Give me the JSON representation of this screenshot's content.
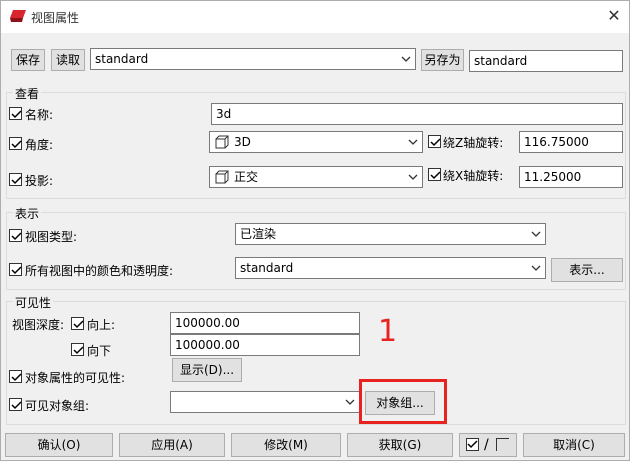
{
  "window": {
    "title": "视图属性",
    "close_glyph": "✕"
  },
  "toolbar": {
    "save": "保存",
    "read": "读取",
    "preset": "standard",
    "save_as": "另存为",
    "save_as_name": "standard"
  },
  "view": {
    "section_title": "查看",
    "name_label": "名称:",
    "name_value": "3d",
    "angle_label": "角度:",
    "angle_value": "3D",
    "rot_z_label": "绕Z轴旋转:",
    "rot_z_value": "116.75000",
    "projection_label": "投影:",
    "projection_value": "正交",
    "rot_x_label": "绕X轴旋转:",
    "rot_x_value": "11.25000"
  },
  "display": {
    "section_title": "表示",
    "view_type_label": "视图类型:",
    "view_type_value": "已渲染",
    "color_label": "所有视图中的颜色和透明度:",
    "color_value": "standard",
    "show_button": "表示..."
  },
  "visibility": {
    "section_title": "可见性",
    "depth_label": "视图深度:",
    "up_label": "向上:",
    "up_value": "100000.00",
    "down_label": "向下",
    "down_value": "100000.00",
    "obj_attr_label": "对象属性的可见性:",
    "display_button": "显示(D)...",
    "obj_group_label": "可见对象组:",
    "obj_group_value": "",
    "obj_group_button": "对象组..."
  },
  "annotation": {
    "number": "1",
    "color": "#e8231f"
  },
  "footer": {
    "ok": "确认(O)",
    "apply": "应用(A)",
    "modify": "修改(M)",
    "get": "获取(G)",
    "toggle_slash": "/",
    "cancel": "取消(C)"
  }
}
